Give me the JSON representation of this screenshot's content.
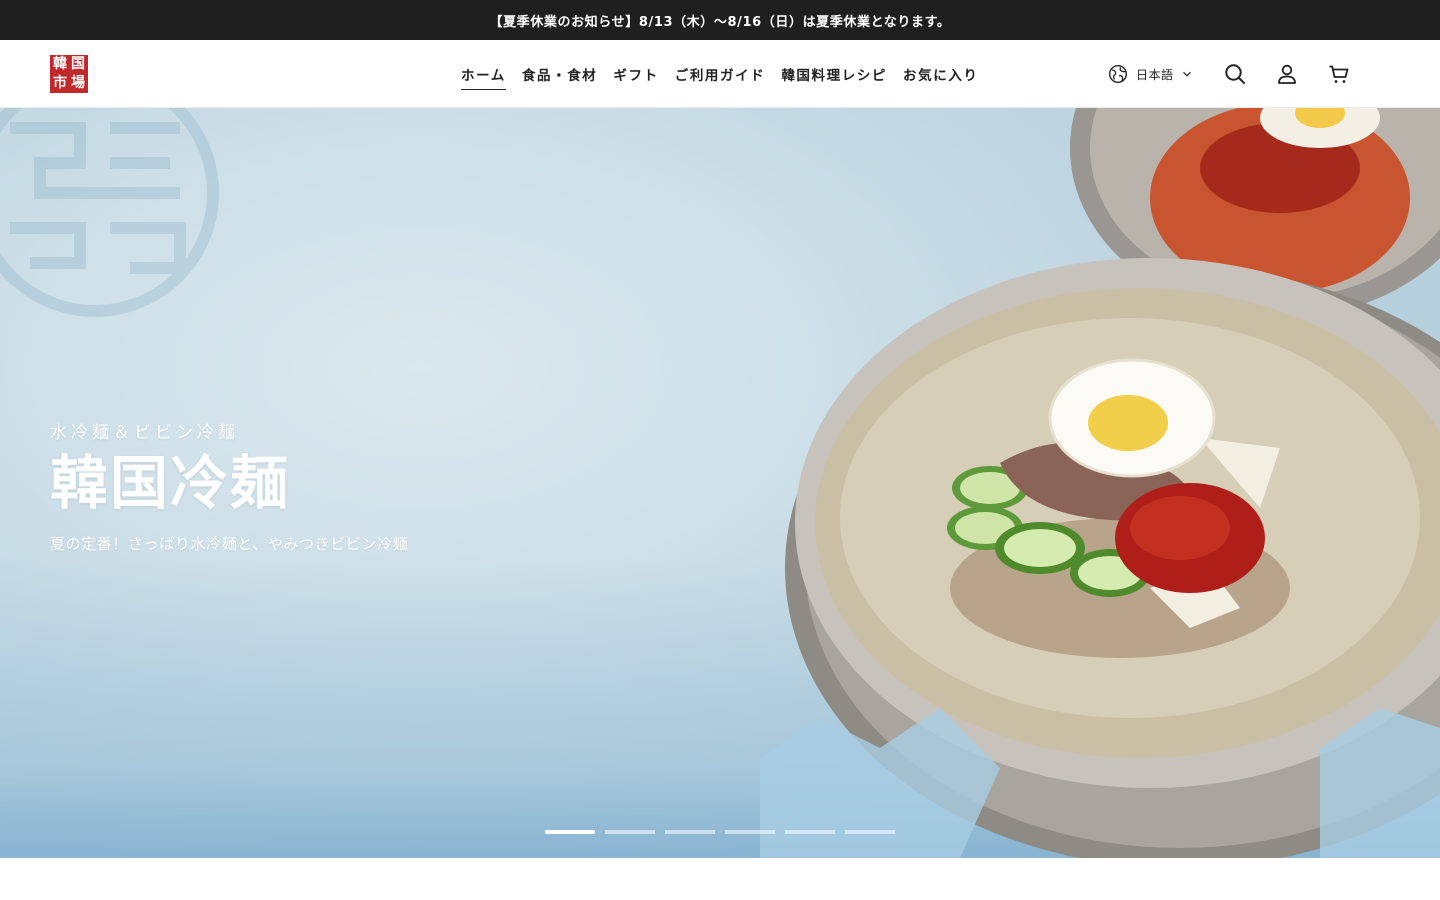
{
  "announcement": "【夏季休業のお知らせ】8/13（木）〜8/16（日）は夏季休業となります。",
  "logo": {
    "chars": [
      "韓",
      "国",
      "市",
      "場"
    ],
    "color": "#c0282a"
  },
  "nav": [
    {
      "label": "ホーム",
      "active": true
    },
    {
      "label": "食品・食材",
      "active": false
    },
    {
      "label": "ギフト",
      "active": false
    },
    {
      "label": "ご利用ガイド",
      "active": false
    },
    {
      "label": "韓国料理レシピ",
      "active": false
    },
    {
      "label": "お気に入り",
      "active": false
    }
  ],
  "language": {
    "label": "日本語",
    "icon": "globe-icon"
  },
  "header_icons": [
    "search-icon",
    "account-icon",
    "cart-icon"
  ],
  "hero": {
    "subtitle": "水冷麺＆ビビン冷麺",
    "title": "韓国冷麺",
    "description": "夏の定番！さっぱり水冷麺と、やみつきビビン冷麺",
    "slides": 6,
    "active_slide": 1
  }
}
